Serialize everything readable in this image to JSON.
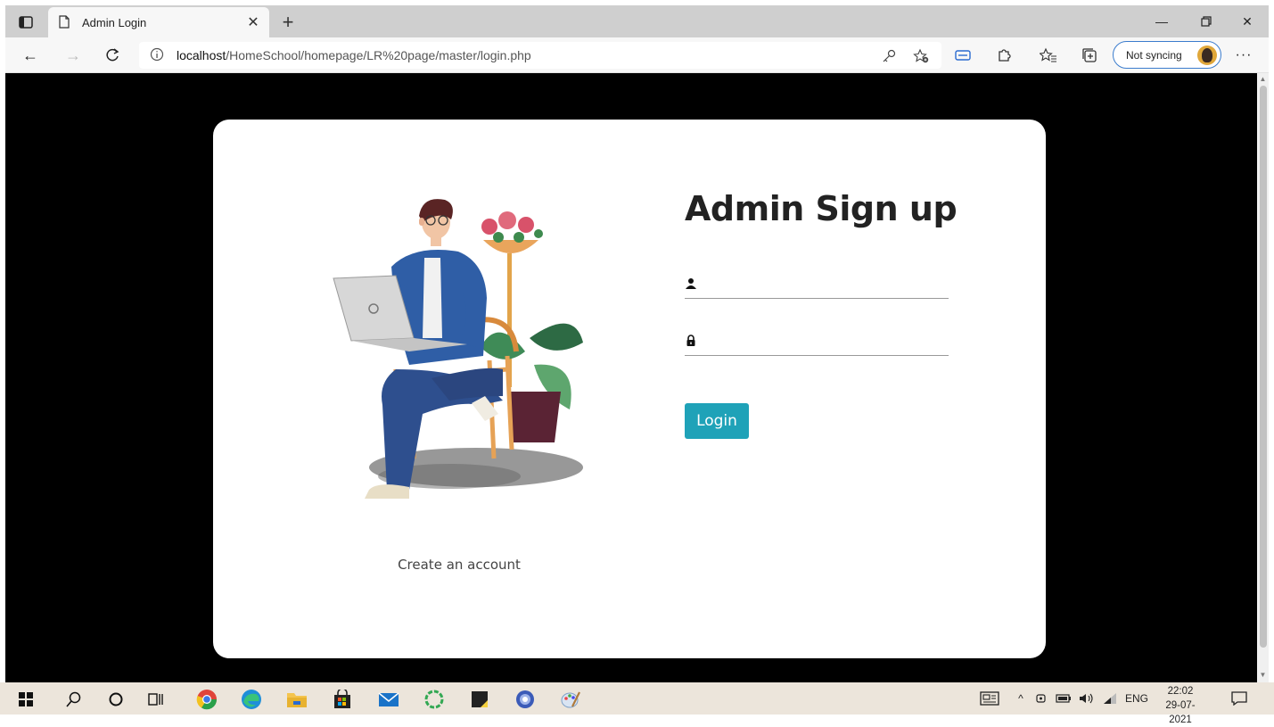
{
  "browser": {
    "tab": {
      "title": "Admin Login"
    },
    "address": {
      "host": "localhost",
      "path": "/HomeSchool/homepage/LR%20page/master/login.php"
    },
    "profile": {
      "label": "Not syncing"
    }
  },
  "page": {
    "title": "Admin Sign up",
    "username": {
      "value": "",
      "icon": "user-icon"
    },
    "password": {
      "value": "",
      "icon": "lock-icon"
    },
    "login_label": "Login",
    "create_account_label": "Create an account",
    "accent_color": "#1fa2b8"
  },
  "taskbar": {
    "language": "ENG",
    "time": "22:02",
    "date": "29-07-2021"
  }
}
